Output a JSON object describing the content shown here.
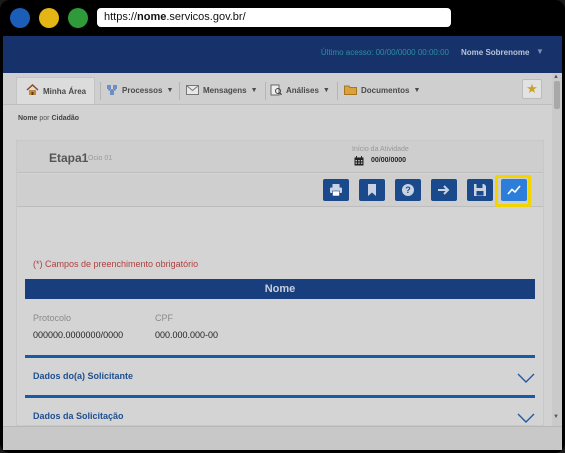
{
  "browser": {
    "url_prefix": "https://",
    "url_bold": "nome",
    "url_suffix": ".servicos.gov.br/"
  },
  "header": {
    "last_access": "Último acesso: 00/00/0000 00:00:00",
    "user_name": "Nome Sobrenome"
  },
  "menu": {
    "items": [
      {
        "label": "Minha Área",
        "icon": "home-icon"
      },
      {
        "label": "Processos",
        "icon": "processes-icon"
      },
      {
        "label": "Mensagens",
        "icon": "envelope-icon"
      },
      {
        "label": "Análises",
        "icon": "analysis-icon"
      },
      {
        "label": "Documentos",
        "icon": "folder-icon"
      }
    ],
    "favorite_icon": "star-icon"
  },
  "breadcrumb": {
    "part1": "Nome",
    "sep": " por ",
    "part2": "Cidadão"
  },
  "stage": {
    "title": "Etapa1",
    "subtitle": "Ocio 01",
    "start_label": "Início da Atividade",
    "start_value": "00/00/0000"
  },
  "toolbar": {
    "buttons": [
      "print-icon",
      "bookmark-icon",
      "help-icon",
      "forward-arrow-icon",
      "save-icon",
      "chart-icon"
    ],
    "highlighted": "chart-icon"
  },
  "form": {
    "required_note": "(*) Campos de preenchimento obrigatório",
    "section_title": "Nome",
    "protocol_label": "Protocolo",
    "protocol_value": "000000.0000000/0000",
    "cpf_label": "CPF",
    "cpf_value": "000.000.000-00"
  },
  "accordions": [
    {
      "title": "Dados do(a) Solicitante"
    },
    {
      "title": "Dados da Solicitação"
    }
  ],
  "colors": {
    "nav": "#17326a",
    "section": "#183e7d",
    "button": "#1a4a8c",
    "highlight": "#f2d400",
    "required": "#b04040"
  }
}
